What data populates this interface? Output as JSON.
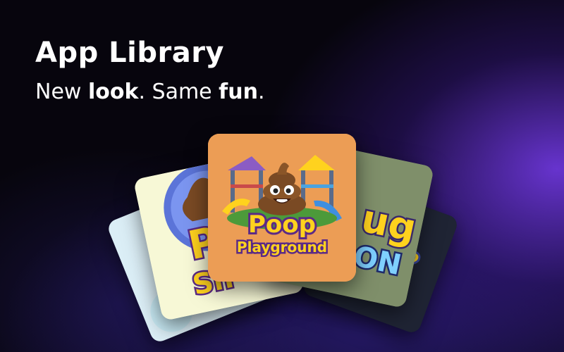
{
  "header": {
    "title": "App Library",
    "subtitle_parts": [
      "New ",
      "look",
      ". Same ",
      "fun",
      "."
    ]
  },
  "cards": {
    "center": {
      "line1": "Poop",
      "line2": "Playground",
      "icon": "poop-emoji-icon",
      "background": "#ec9d55"
    },
    "left": {
      "text_top": "P",
      "text_bottom": "Sh",
      "background": "#f7f8d6"
    },
    "right": {
      "text_top": "ug",
      "text_bottom": "ON",
      "background": "#7f8f6a"
    },
    "far_left": {
      "background": "#dbeef6"
    },
    "far_right": {
      "background": "#1f2434"
    }
  },
  "colors": {
    "background": "#07050d",
    "glow": "#7a3cf0",
    "logo_yellow": "#ffd21e",
    "logo_purple": "#5b2a86",
    "poop_brown": "#7a4a24"
  }
}
